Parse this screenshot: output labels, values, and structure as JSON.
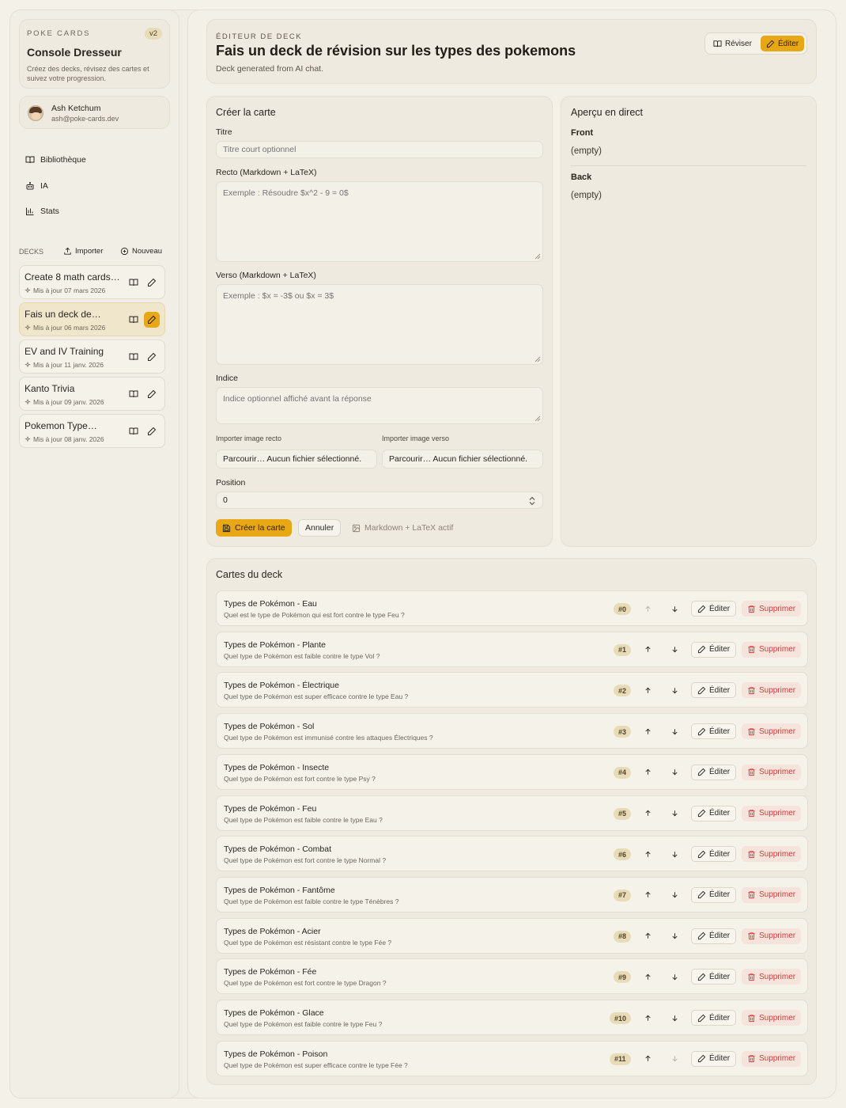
{
  "brand": {
    "kicker": "POKE CARDS",
    "version": "v2",
    "title": "Console Dresseur",
    "subtitle": "Créez des decks, révisez des cartes et suivez votre progression."
  },
  "user": {
    "name": "Ash Ketchum",
    "email": "ash@poke-cards.dev"
  },
  "nav": [
    {
      "label": "Bibliothèque",
      "icon": "book-icon"
    },
    {
      "label": "IA",
      "icon": "bot-icon"
    },
    {
      "label": "Stats",
      "icon": "bar-chart-icon"
    }
  ],
  "decks_section": {
    "label": "DECKS",
    "import_label": "Importer",
    "new_label": "Nouveau"
  },
  "decks": [
    {
      "name": "Create 8 math cards…",
      "updated": "Mis à jour 07 mars 2026",
      "active": false
    },
    {
      "name": "Fais un deck de…",
      "updated": "Mis à jour 06 mars 2026",
      "active": true
    },
    {
      "name": "EV and IV Training",
      "updated": "Mis à jour 11 janv. 2026",
      "active": false
    },
    {
      "name": "Kanto Trivia",
      "updated": "Mis à jour 09 janv. 2026",
      "active": false
    },
    {
      "name": "Pokemon Type…",
      "updated": "Mis à jour 08 janv. 2026",
      "active": false
    }
  ],
  "header": {
    "kicker": "ÉDITEUR DE DECK",
    "title": "Fais un deck de révision sur les types des pokemons",
    "subtitle": "Deck generated from AI chat.",
    "review_label": "Réviser",
    "edit_label": "Éditer"
  },
  "form": {
    "title": "Créer la carte",
    "title_label": "Titre",
    "title_placeholder": "Titre court optionnel",
    "front_label": "Recto (Markdown + LaTeX)",
    "front_placeholder": "Exemple : Résoudre $x^2 - 9 = 0$",
    "back_label": "Verso (Markdown + LaTeX)",
    "back_placeholder": "Exemple : $x = -3$ ou $x = 3$",
    "hint_label": "Indice",
    "hint_placeholder": "Indice optionnel affiché avant la réponse",
    "import_front_label": "Importer image recto",
    "import_back_label": "Importer image verso",
    "file_front": "Parcourir… Aucun fichier sélectionné.",
    "file_back": "Parcourir… Aucun fichier sélectionné.",
    "position_label": "Position",
    "position_value": "0",
    "create_label": "Créer la carte",
    "cancel_label": "Annuler",
    "md_note": "Markdown + LaTeX actif"
  },
  "preview": {
    "title": "Aperçu en direct",
    "front_label": "Front",
    "front_value": "(empty)",
    "back_label": "Back",
    "back_value": "(empty)"
  },
  "cards_section": {
    "title": "Cartes du deck",
    "edit_label": "Éditer",
    "delete_label": "Supprimer"
  },
  "cards": [
    {
      "title": "Types de Pokémon - Eau",
      "question": "Quel est le type de Pokémon qui est fort contre le type Feu ?",
      "pos": "#0"
    },
    {
      "title": "Types de Pokémon - Plante",
      "question": "Quel type de Pokémon est faible contre le type Vol ?",
      "pos": "#1"
    },
    {
      "title": "Types de Pokémon - Électrique",
      "question": "Quel type de Pokémon est super efficace contre le type Eau ?",
      "pos": "#2"
    },
    {
      "title": "Types de Pokémon - Sol",
      "question": "Quel type de Pokémon est immunisé contre les attaques Électriques ?",
      "pos": "#3"
    },
    {
      "title": "Types de Pokémon - Insecte",
      "question": "Quel type de Pokémon est fort contre le type Psy ?",
      "pos": "#4"
    },
    {
      "title": "Types de Pokémon - Feu",
      "question": "Quel type de Pokémon est faible contre le type Eau ?",
      "pos": "#5"
    },
    {
      "title": "Types de Pokémon - Combat",
      "question": "Quel type de Pokémon est fort contre le type Normal ?",
      "pos": "#6"
    },
    {
      "title": "Types de Pokémon - Fantôme",
      "question": "Quel type de Pokémon est faible contre le type Ténèbres ?",
      "pos": "#7"
    },
    {
      "title": "Types de Pokémon - Acier",
      "question": "Quel type de Pokémon est résistant contre le type Fée ?",
      "pos": "#8"
    },
    {
      "title": "Types de Pokémon - Fée",
      "question": "Quel type de Pokémon est fort contre le type Dragon ?",
      "pos": "#9"
    },
    {
      "title": "Types de Pokémon - Glace",
      "question": "Quel type de Pokémon est faible contre le type Feu ?",
      "pos": "#10"
    },
    {
      "title": "Types de Pokémon - Poison",
      "question": "Quel type de Pokémon est super efficace contre le type Fée ?",
      "pos": "#11"
    }
  ],
  "colors": {
    "accent": "#e8a816",
    "danger": "#d23b3b",
    "background": "#f4f1e9"
  }
}
